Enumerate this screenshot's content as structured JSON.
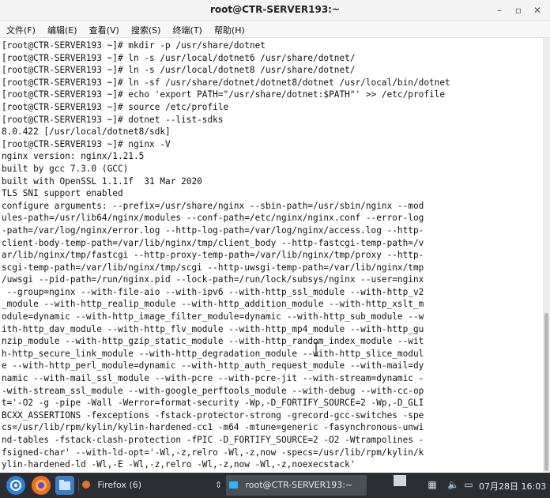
{
  "window": {
    "title": "root@CTR-SERVER193:~"
  },
  "menu": [
    "文件(F)",
    "编辑(E)",
    "查看(V)",
    "搜索(S)",
    "终端(T)",
    "帮助(H)"
  ],
  "terminal": {
    "lines": [
      "[root@CTR-SERVER193 ~]# mkdir -p /usr/share/dotnet",
      "[root@CTR-SERVER193 ~]# ln -s /usr/local/dotnet6 /usr/share/dotnet/",
      "[root@CTR-SERVER193 ~]# ln -s /usr/local/dotnet8 /usr/share/dotnet/",
      "[root@CTR-SERVER193 ~]# ln -sf /usr/share/dotnet/dotnet8/dotnet /usr/local/bin/dotnet",
      "[root@CTR-SERVER193 ~]# echo 'export PATH=\"/usr/share/dotnet:$PATH\"' >> /etc/profile",
      "[root@CTR-SERVER193 ~]# source /etc/profile",
      "[root@CTR-SERVER193 ~]# dotnet --list-sdks",
      "8.0.422 [/usr/local/dotnet8/sdk]",
      "[root@CTR-SERVER193 ~]# nginx -V",
      "nginx version: nginx/1.21.5",
      "built by gcc 7.3.0 (GCC)",
      "built with OpenSSL 1.1.1f  31 Mar 2020",
      "TLS SNI support enabled",
      "configure arguments: --prefix=/usr/share/nginx --sbin-path=/usr/sbin/nginx --mod",
      "ules-path=/usr/lib64/nginx/modules --conf-path=/etc/nginx/nginx.conf --error-log",
      "-path=/var/log/nginx/error.log --http-log-path=/var/log/nginx/access.log --http-",
      "client-body-temp-path=/var/lib/nginx/tmp/client_body --http-fastcgi-temp-path=/v",
      "ar/lib/nginx/tmp/fastcgi --http-proxy-temp-path=/var/lib/nginx/tmp/proxy --http-",
      "scgi-temp-path=/var/lib/nginx/tmp/scgi --http-uwsgi-temp-path=/var/lib/nginx/tmp",
      "/uwsgi --pid-path=/run/nginx.pid --lock-path=/run/lock/subsys/nginx --user=nginx",
      " --group=nginx --with-file-aio --with-ipv6 --with-http_ssl_module --with-http_v2",
      "_module --with-http_realip_module --with-http_addition_module --with-http_xslt_m",
      "odule=dynamic --with-http_image_filter_module=dynamic --with-http_sub_module --w",
      "ith-http_dav_module --with-http_flv_module --with-http_mp4_module --with-http_gu",
      "nzip_module --with-http_gzip_static_module --with-http_random_index_module --wit",
      "h-http_secure_link_module --with-http_degradation_module --with-http_slice_modul",
      "e --with-http_perl_module=dynamic --with-http_auth_request_module --with-mail=dy",
      "namic --with-mail_ssl_module --with-pcre --with-pcre-jit --with-stream=dynamic -",
      "-with-stream_ssl_module --with-google_perftools_module --with-debug --with-cc-op",
      "t='-O2 -g -pipe -Wall -Werror=format-security -Wp,-D_FORTIFY_SOURCE=2 -Wp,-D_GLI",
      "BCXX_ASSERTIONS -fexceptions -fstack-protector-strong -grecord-gcc-switches -spe",
      "cs=/usr/lib/rpm/kylin/kylin-hardened-cc1 -m64 -mtune=generic -fasynchronous-unwi",
      "nd-tables -fstack-clash-protection -fPIC -D_FORTIFY_SOURCE=2 -O2 -Wtrampolines -",
      "fsigned-char' --with-ld-opt='-Wl,-z,relro -Wl,-z,now -specs=/usr/lib/rpm/kylin/k",
      "ylin-hardened-ld -Wl,-E -Wl,-z,relro -Wl,-z,now -Wl,-z,noexecstack'"
    ]
  },
  "taskbar": {
    "firefox_label": "Firefox (6)",
    "terminal_label": "root@CTR-SERVER193:~",
    "clock": "07月28日 16:03"
  },
  "icons": {
    "start": "start-menu-icon",
    "firefox_launcher": "firefox-icon",
    "files": "file-manager-icon",
    "terminal": "terminal-icon"
  }
}
